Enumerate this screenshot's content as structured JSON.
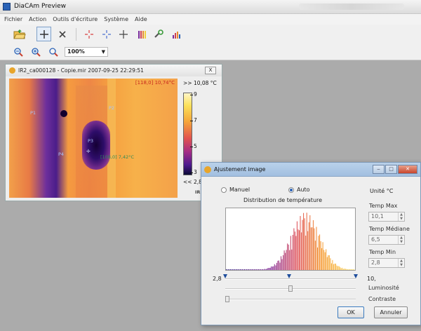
{
  "app": {
    "title": "DiaCAm Preview"
  },
  "menu": [
    "Fichier",
    "Action",
    "Outils d'écriture",
    "Système",
    "Aide"
  ],
  "toolbar": {
    "zoom": "100%"
  },
  "image_window": {
    "title": "IR2_ca000128 - Copie.mir 2007-09-25 22:29:51",
    "close_label": "X",
    "readout_top": "[118,0] 10,74°C",
    "points": [
      "P1",
      "P2",
      "P3",
      "P4"
    ],
    "center_readout": "[108,0] 7,42°C",
    "scale": {
      "max_label": ">> 10,08 °C",
      "ticks": [
        "9",
        "7",
        "5",
        "3"
      ],
      "min_label": "<< 2,8",
      "footer": "IR"
    }
  },
  "dialog": {
    "title": "Ajustement image",
    "mode": {
      "manual": "Manuel",
      "auto": "Auto",
      "selected": "auto"
    },
    "distribution_label": "Distribution de température",
    "unit_label": "Unité °C",
    "temp_max_label": "Temp Max",
    "temp_max_value": "10,1",
    "temp_median_label": "Temp Médiane",
    "temp_median_value": "6,5",
    "temp_min_label": "Temp Min",
    "temp_min_value": "2,8",
    "range_min": "2,8",
    "range_max": "10,",
    "luminosity_label": "Luminosité",
    "contrast_label": "Contraste",
    "luminosity_level": 0.5,
    "contrast_level": 0.0,
    "ok_label": "OK",
    "cancel_label": "Annuler"
  },
  "colors": {
    "accent": "#2a62b6",
    "dialog_titlebar": "#a2bfe0",
    "workspace": "#ababab"
  }
}
